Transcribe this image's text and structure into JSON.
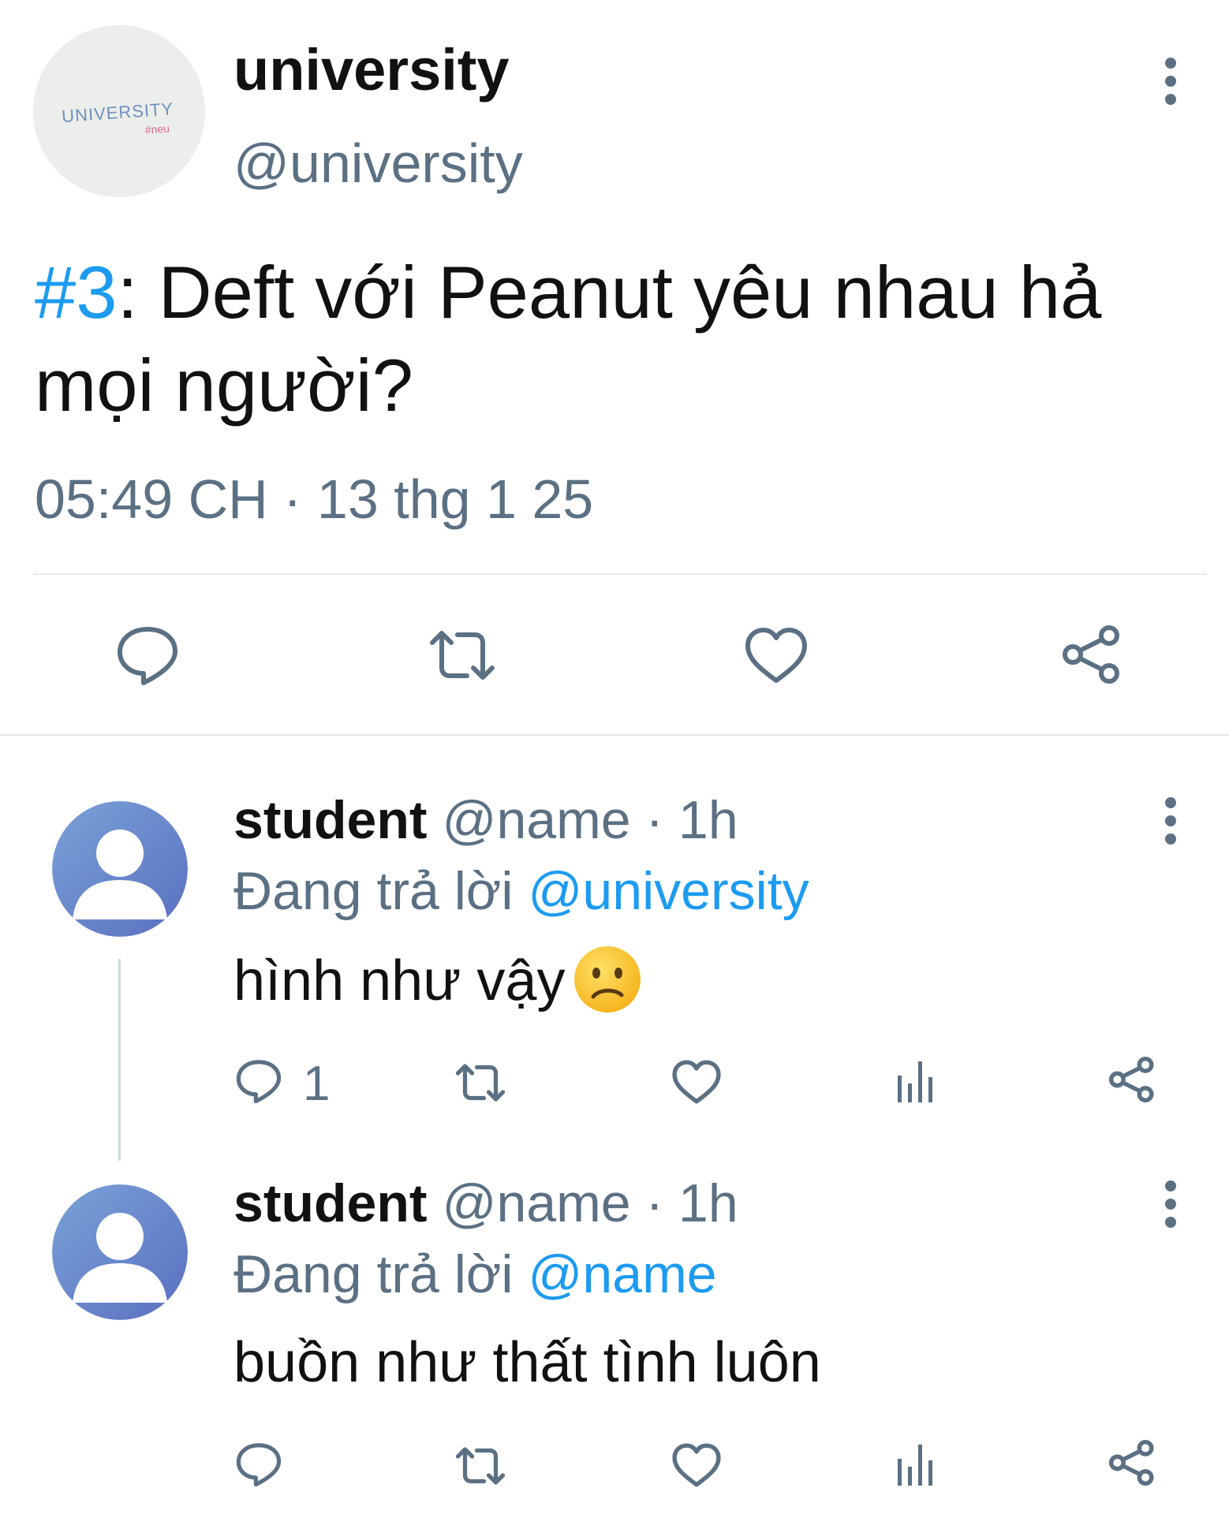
{
  "main_tweet": {
    "avatar_text": "UNIVERSITY",
    "avatar_subtext": "#neu",
    "name": "university",
    "handle": "@university",
    "hashtag": "#3",
    "text": ": Deft với Peanut yêu nhau hả mọi người?",
    "timestamp": "05:49 CH · 13 thg 1 25",
    "actions": [
      "reply-icon",
      "retweet-icon",
      "like-icon",
      "share-icon"
    ]
  },
  "replies": [
    {
      "name": "student",
      "handle_time": " @name · 1h",
      "replying_prefix": "Đang trả lời ",
      "replying_to": "@university",
      "text": "hình như vậy",
      "emoji": "confused-face",
      "reply_count": "1"
    },
    {
      "name": "student",
      "handle_time": " @name · 1h",
      "replying_prefix": "Đang trả lời ",
      "replying_to": "@name",
      "text": "buồn như thất tình luôn",
      "reply_count": ""
    }
  ],
  "colors": {
    "accent": "#1d9bf0",
    "secondary_text": "#5b7083",
    "avatar_gradient_start": "#7aa2d8",
    "avatar_gradient_end": "#5a6fc0"
  }
}
